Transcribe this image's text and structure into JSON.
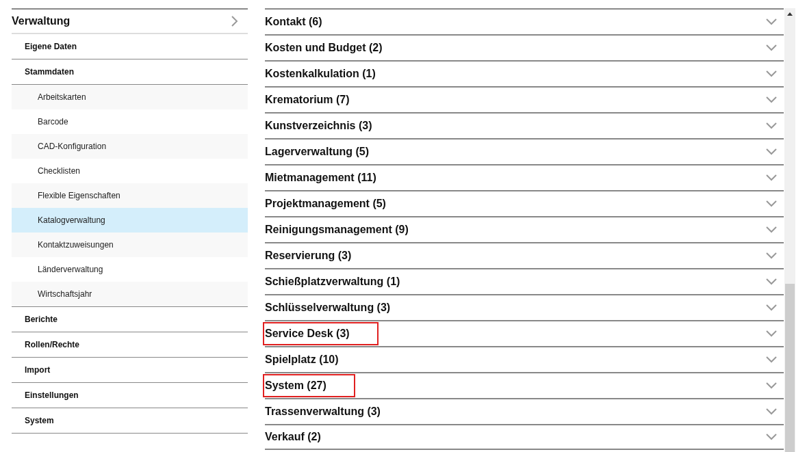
{
  "sidebar": {
    "title": "Verwaltung",
    "items": [
      {
        "label": "Eigene Daten"
      },
      {
        "label": "Stammdaten",
        "children": [
          {
            "label": "Arbeitskarten",
            "selected": false
          },
          {
            "label": "Barcode",
            "selected": false
          },
          {
            "label": "CAD-Konfiguration",
            "selected": false
          },
          {
            "label": "Checklisten",
            "selected": false
          },
          {
            "label": "Flexible Eigenschaften",
            "selected": false
          },
          {
            "label": "Katalogverwaltung",
            "selected": true
          },
          {
            "label": "Kontaktzuweisungen",
            "selected": false
          },
          {
            "label": "Länderverwaltung",
            "selected": false
          },
          {
            "label": "Wirtschaftsjahr",
            "selected": false
          }
        ]
      },
      {
        "label": "Berichte"
      },
      {
        "label": "Rollen/Rechte"
      },
      {
        "label": "Import"
      },
      {
        "label": "Einstellungen"
      },
      {
        "label": "System"
      }
    ]
  },
  "categories": [
    {
      "label": "Kontakt (6)",
      "expanded": false,
      "highlighted": false
    },
    {
      "label": "Kosten und Budget (2)",
      "expanded": false,
      "highlighted": false
    },
    {
      "label": "Kostenkalkulation (1)",
      "expanded": false,
      "highlighted": false
    },
    {
      "label": "Krematorium (7)",
      "expanded": false,
      "highlighted": false
    },
    {
      "label": "Kunstverzeichnis (3)",
      "expanded": false,
      "highlighted": false
    },
    {
      "label": "Lagerverwaltung (5)",
      "expanded": false,
      "highlighted": false
    },
    {
      "label": "Mietmanagement (11)",
      "expanded": false,
      "highlighted": false
    },
    {
      "label": "Projektmanagement (5)",
      "expanded": false,
      "highlighted": false
    },
    {
      "label": "Reinigungsmanagement (9)",
      "expanded": false,
      "highlighted": false
    },
    {
      "label": "Reservierung (3)",
      "expanded": false,
      "highlighted": false
    },
    {
      "label": "Schießplatzverwaltung (1)",
      "expanded": false,
      "highlighted": false
    },
    {
      "label": "Schlüsselverwaltung (3)",
      "expanded": false,
      "highlighted": false
    },
    {
      "label": "Service Desk (3)",
      "expanded": false,
      "highlighted": true
    },
    {
      "label": "Spielplatz (10)",
      "expanded": false,
      "highlighted": false
    },
    {
      "label": "System (27)",
      "expanded": false,
      "highlighted": true
    },
    {
      "label": "Trassenverwaltung (3)",
      "expanded": false,
      "highlighted": false
    },
    {
      "label": "Verkauf (2)",
      "expanded": false,
      "highlighted": false
    }
  ]
}
